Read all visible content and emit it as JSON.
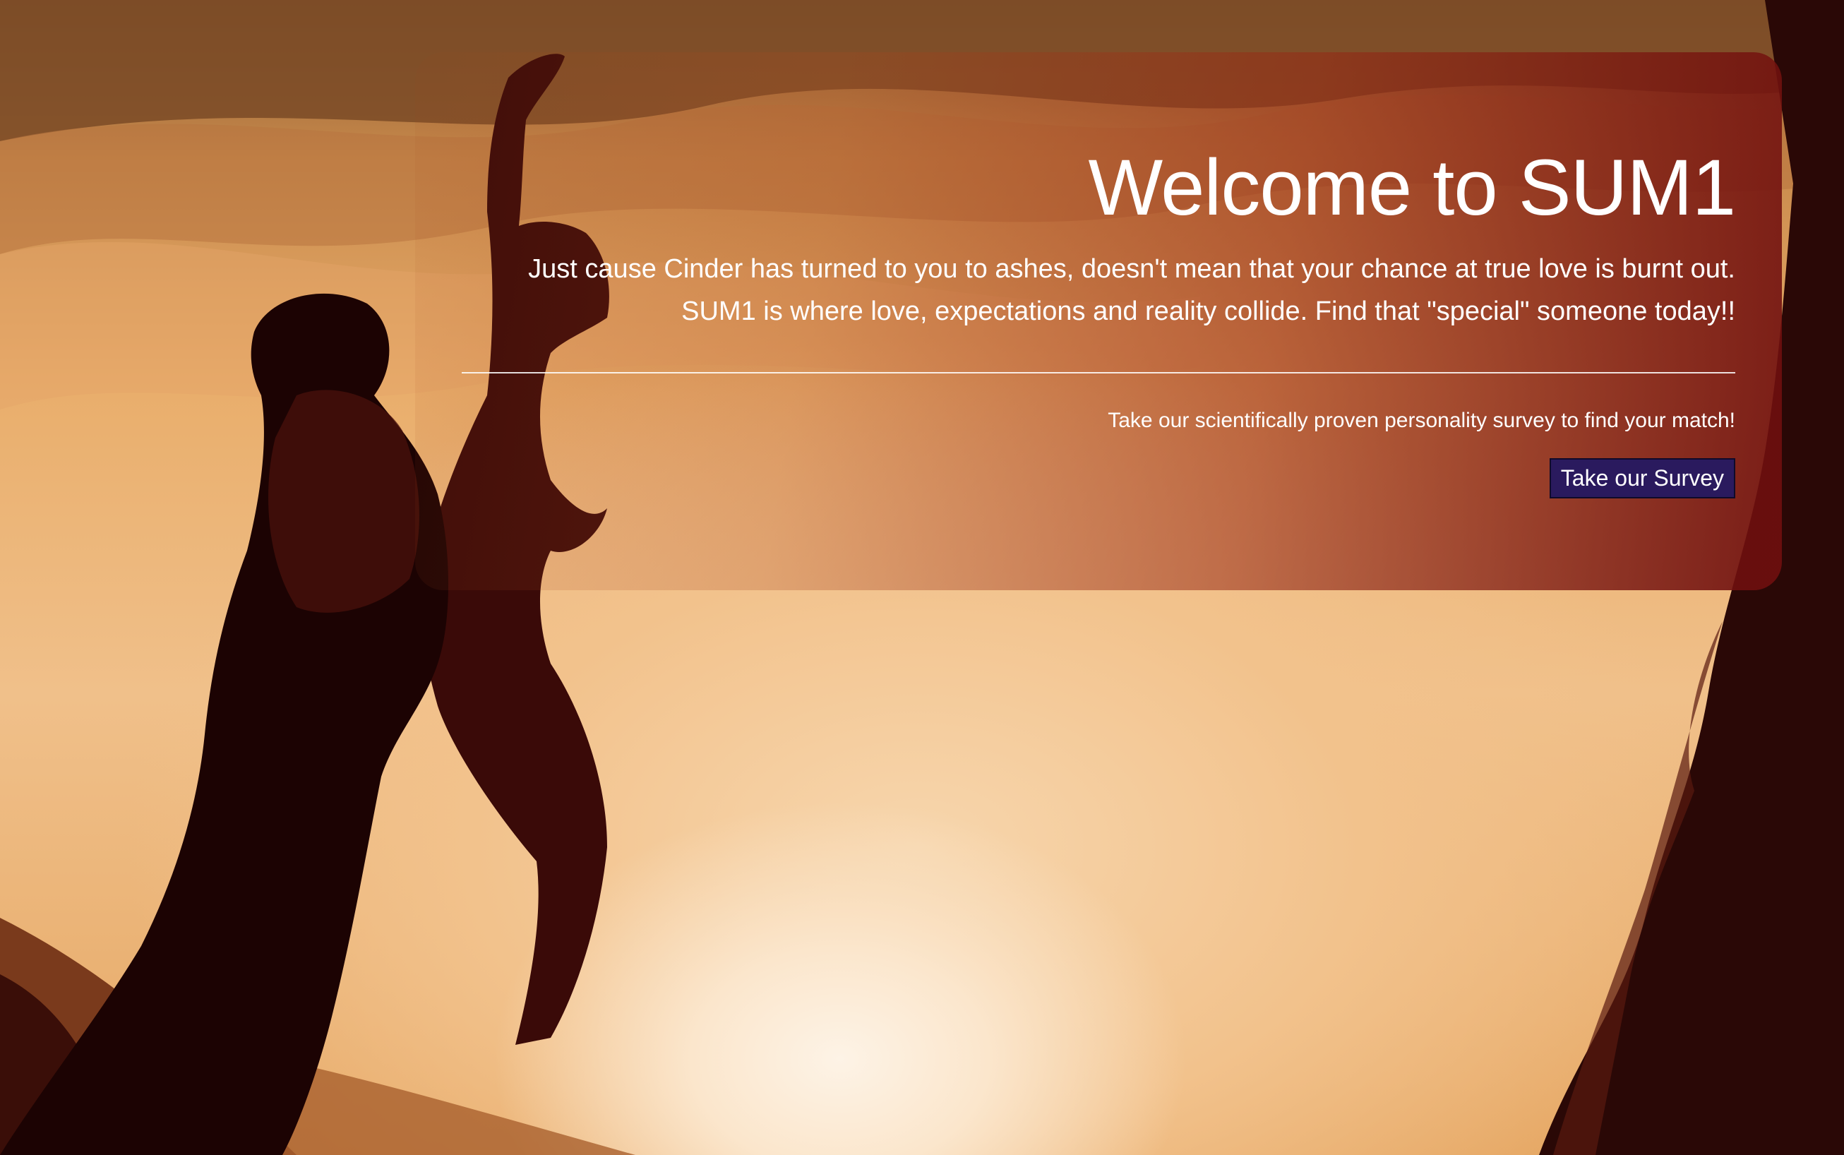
{
  "colors": {
    "button_bg": "#2a1a5e",
    "panel_gradient_end": "#6e0e0e",
    "text": "#ffffff"
  },
  "background": {
    "description_icon": "couple-silhouette-sunset-illustration"
  },
  "jumbotron": {
    "title": "Welcome to SUM1",
    "lead_line_1": "Just cause Cinder has turned to you to ashes, doesn't mean that your chance at true love is burnt out.",
    "lead_line_2": "SUM1 is where love, expectations and reality collide. Find that \"special\" someone today!!",
    "survey_prompt": "Take our scientifically proven personality survey to find your match!",
    "survey_button_label": "Take our Survey"
  }
}
